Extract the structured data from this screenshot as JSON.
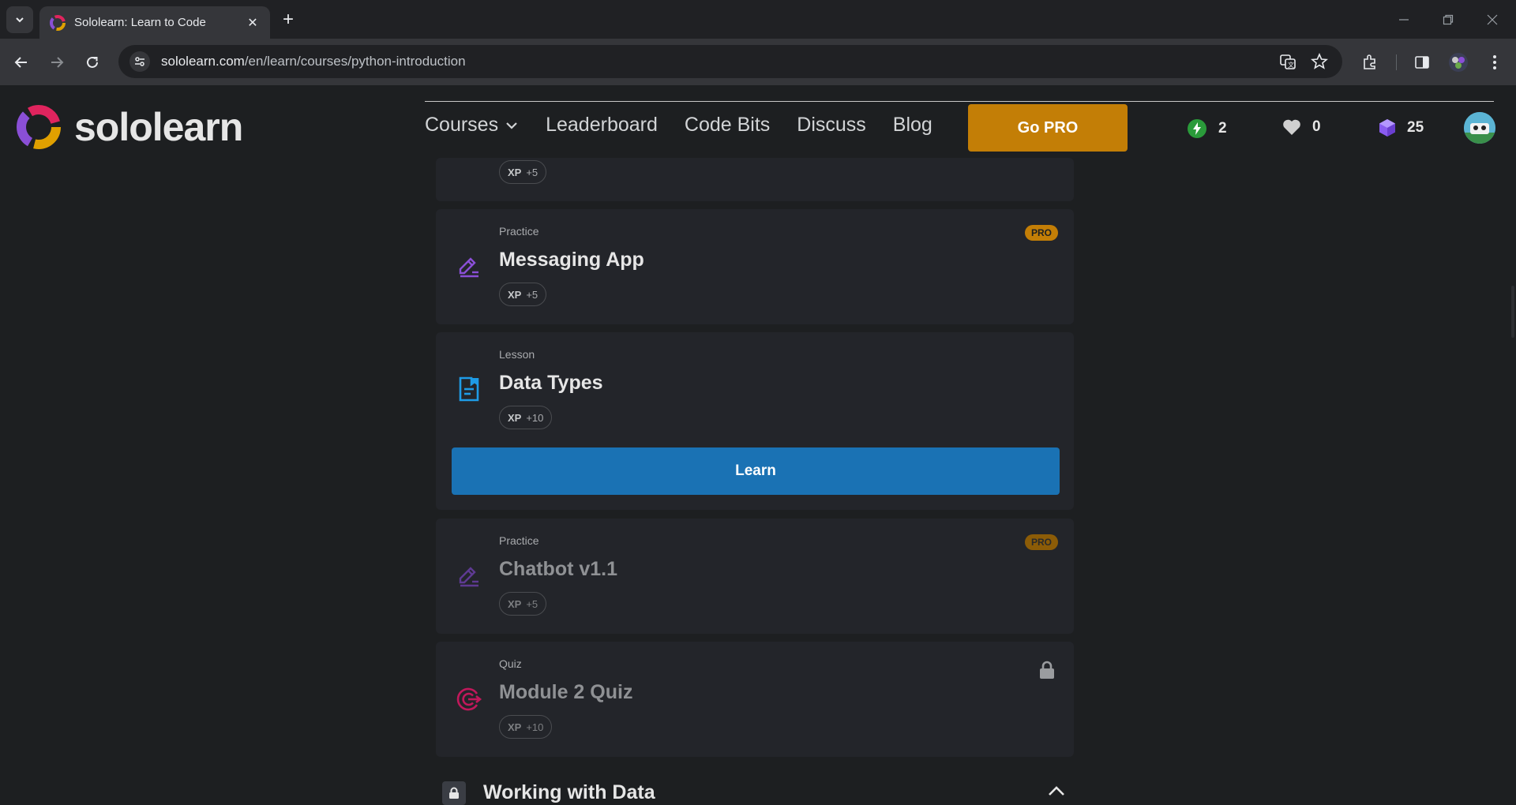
{
  "browser": {
    "tab_title": "Sololearn: Learn to Code",
    "url_host": "sololearn.com",
    "url_path": "/en/learn/courses/python-introduction"
  },
  "site": {
    "logo_text": "sololearn",
    "nav": [
      {
        "label": "Courses"
      },
      {
        "label": "Leaderboard"
      },
      {
        "label": "Code Bits"
      },
      {
        "label": "Discuss"
      },
      {
        "label": "Blog"
      }
    ],
    "go_pro": "Go PRO",
    "stats": {
      "streak": "2",
      "hearts": "0",
      "gems": "25"
    }
  },
  "lessons": {
    "top_card": {
      "xp_label": "XP",
      "xp_value": "+5"
    },
    "messaging": {
      "kind": "Practice",
      "name": "Messaging App",
      "badge": "PRO",
      "xp_label": "XP",
      "xp_value": "+5"
    },
    "datatypes": {
      "kind": "Lesson",
      "name": "Data Types",
      "xp_label": "XP",
      "xp_value": "+10",
      "button": "Learn"
    },
    "chatbot": {
      "kind": "Practice",
      "name": "Chatbot v1.1",
      "badge": "PRO",
      "xp_label": "XP",
      "xp_value": "+5"
    },
    "quiz": {
      "kind": "Quiz",
      "name": "Module 2 Quiz",
      "xp_label": "XP",
      "xp_value": "+10"
    }
  },
  "next_section": {
    "title": "Working with Data"
  },
  "colors": {
    "accent_pro": "#c37e06",
    "learn_blue": "#1a72b4",
    "practice_purple": "#8a4fd6",
    "lesson_blue": "#1e9be6",
    "quiz_red": "#c1185b"
  }
}
